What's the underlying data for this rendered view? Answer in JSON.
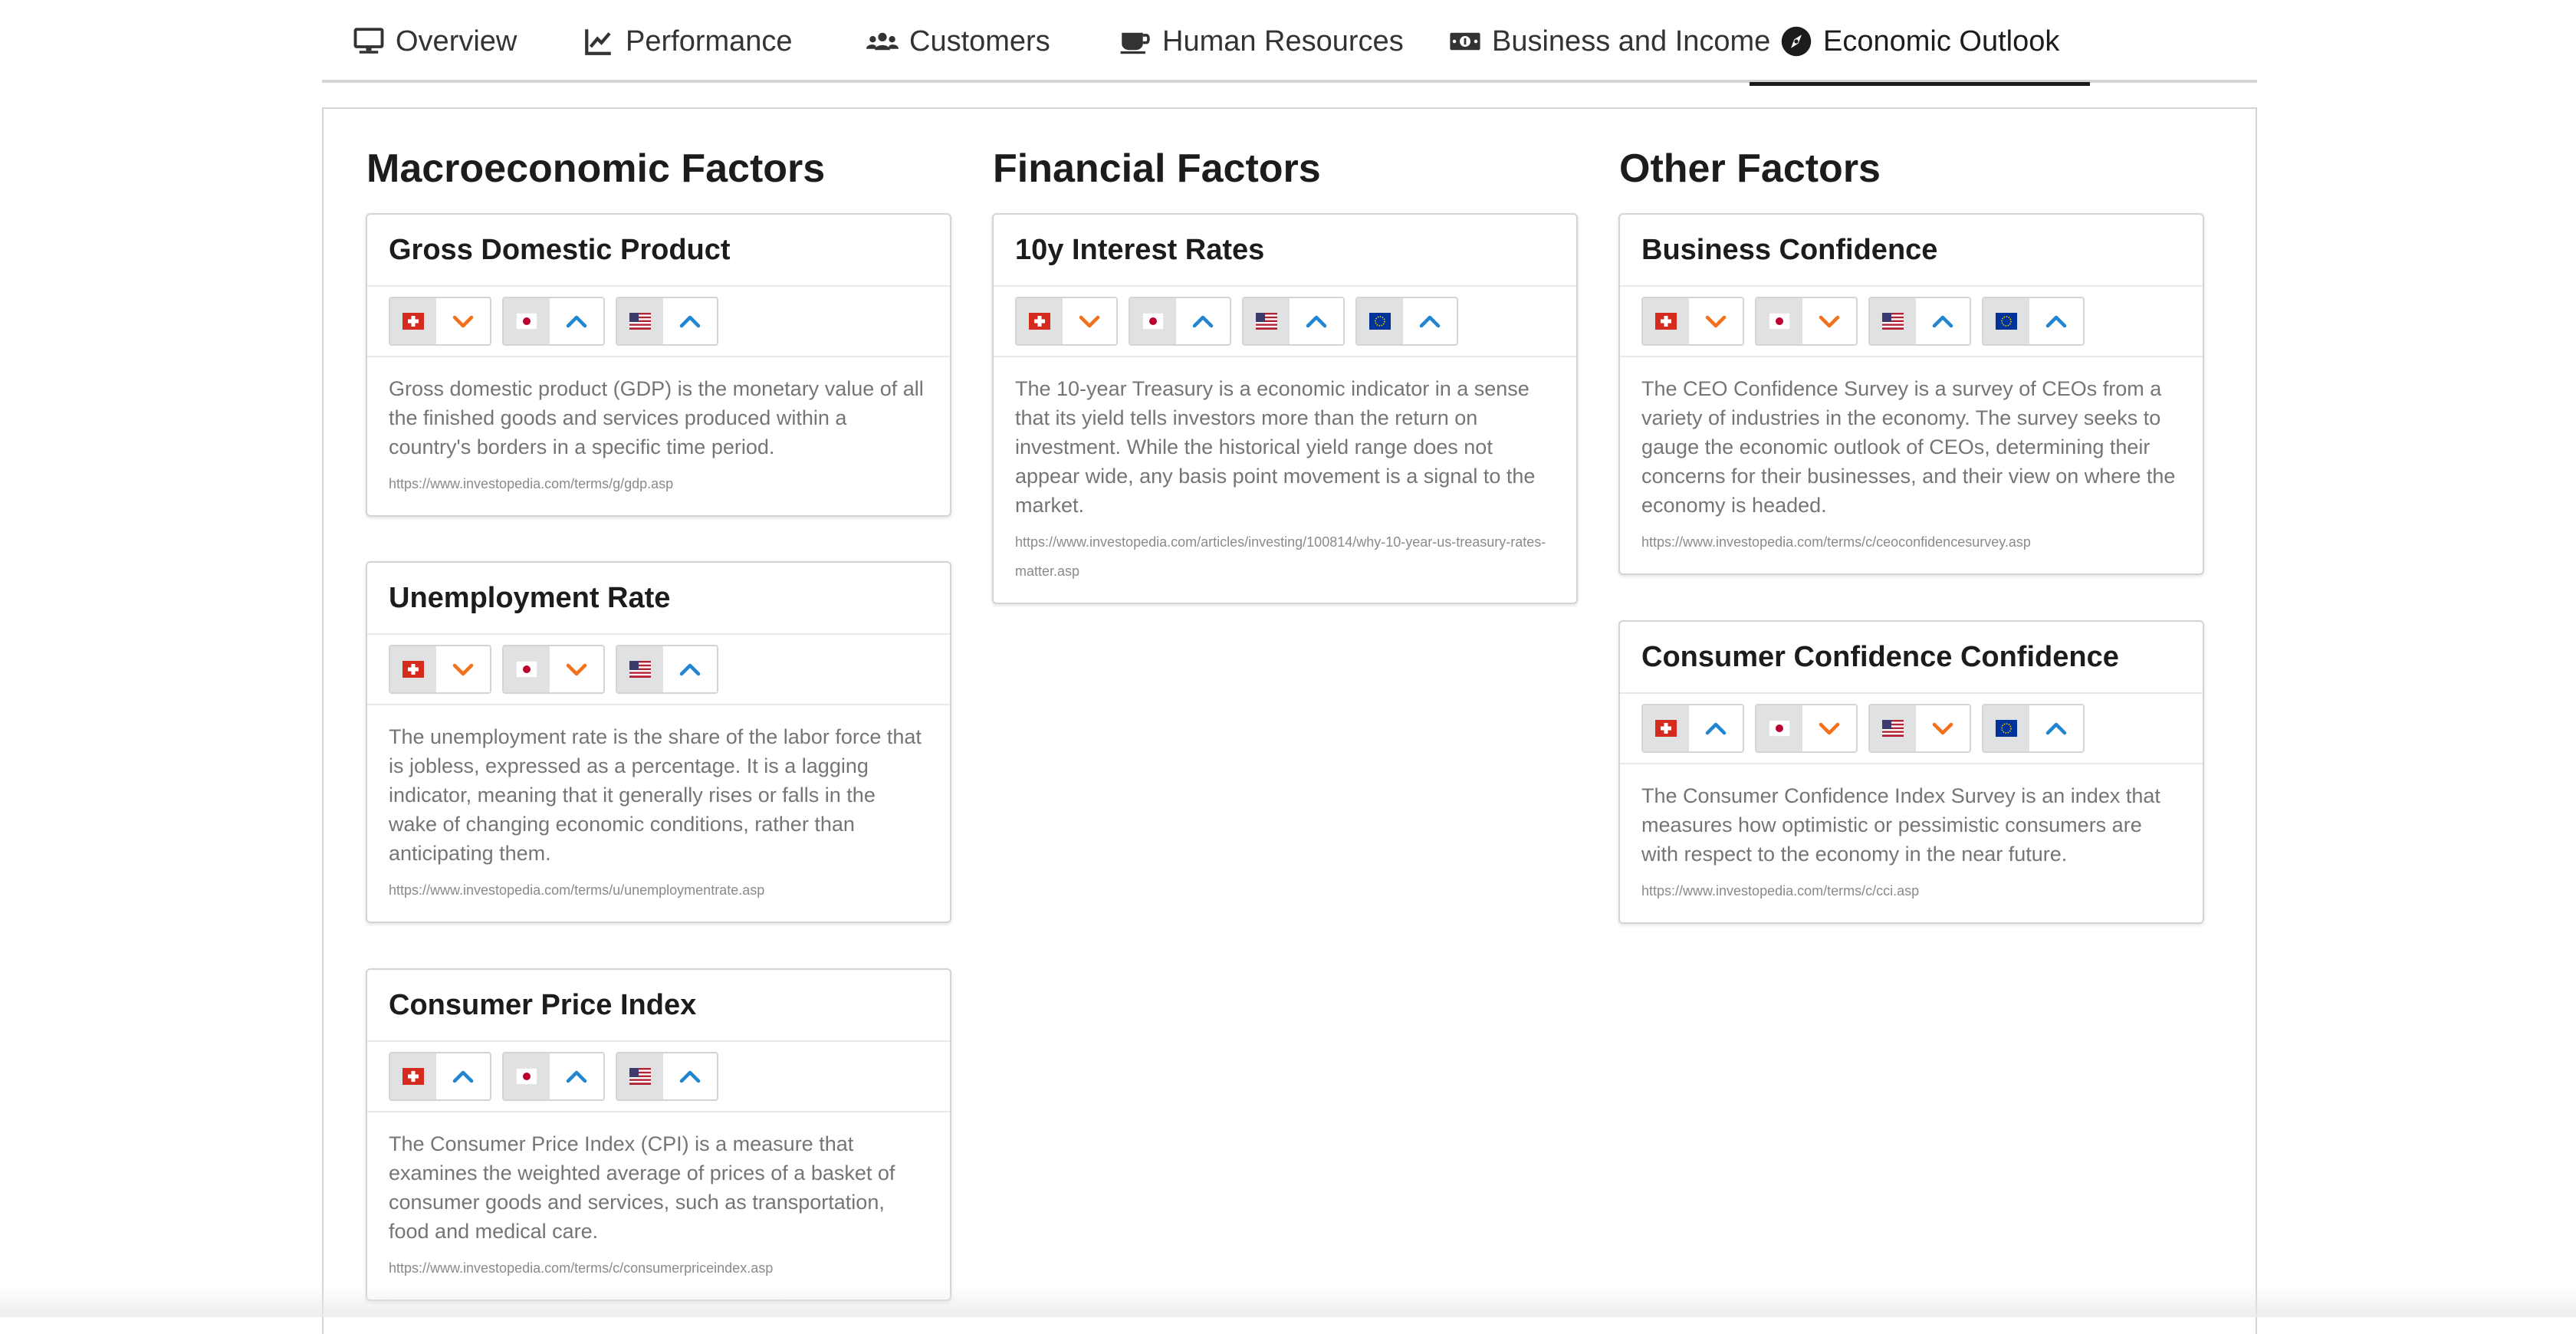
{
  "tabs": [
    {
      "label": "Overview",
      "icon": "monitor-icon"
    },
    {
      "label": "Performance",
      "icon": "line-chart-icon"
    },
    {
      "label": "Customers",
      "icon": "users-icon"
    },
    {
      "label": "Human Resources",
      "icon": "coffee-icon"
    },
    {
      "label": "Business and Income",
      "icon": "money-icon"
    },
    {
      "label": "Economic Outlook",
      "icon": "compass-icon",
      "active": true
    }
  ],
  "columns": [
    {
      "title": "Macroeconomic Factors",
      "cards": [
        {
          "title": "Gross Domestic Product",
          "indicators": [
            {
              "country": "switzerland",
              "trend": "down"
            },
            {
              "country": "japan",
              "trend": "up"
            },
            {
              "country": "usa",
              "trend": "up"
            }
          ],
          "description": "Gross domestic product (GDP) is the monetary value of all the finished goods and services produced within a country's borders in a specific time period.",
          "link": "https://www.investopedia.com/terms/g/gdp.asp"
        },
        {
          "title": "Unemployment Rate",
          "indicators": [
            {
              "country": "switzerland",
              "trend": "down"
            },
            {
              "country": "japan",
              "trend": "down"
            },
            {
              "country": "usa",
              "trend": "up"
            }
          ],
          "description": "The unemployment rate is the share of the labor force that is jobless, expressed as a percentage. It is a lagging indicator, meaning that it generally rises or falls in the wake of changing economic conditions, rather than anticipating them.",
          "link": "https://www.investopedia.com/terms/u/unemploymentrate.asp"
        },
        {
          "title": "Consumer Price Index",
          "indicators": [
            {
              "country": "switzerland",
              "trend": "up"
            },
            {
              "country": "japan",
              "trend": "up"
            },
            {
              "country": "usa",
              "trend": "up"
            }
          ],
          "description": "The Consumer Price Index (CPI) is a measure that examines the weighted average of prices of a basket of consumer goods and services, such as transportation, food and medical care.",
          "link": "https://www.investopedia.com/terms/c/consumerpriceindex.asp"
        }
      ]
    },
    {
      "title": "Financial Factors",
      "cards": [
        {
          "title": "10y Interest Rates",
          "indicators": [
            {
              "country": "switzerland",
              "trend": "down"
            },
            {
              "country": "japan",
              "trend": "up"
            },
            {
              "country": "usa",
              "trend": "up"
            },
            {
              "country": "eu",
              "trend": "up"
            }
          ],
          "description": "The 10-year Treasury is a economic indicator in a sense that its yield tells investors more than the return on investment. While the historical yield range does not appear wide, any basis point movement is a signal to the market.",
          "link": "https://www.investopedia.com/articles/investing/100814/why-10-year-us-treasury-rates-matter.asp"
        }
      ]
    },
    {
      "title": "Other Factors",
      "cards": [
        {
          "title": "Business Confidence",
          "indicators": [
            {
              "country": "switzerland",
              "trend": "down"
            },
            {
              "country": "japan",
              "trend": "down"
            },
            {
              "country": "usa",
              "trend": "up"
            },
            {
              "country": "eu",
              "trend": "up"
            }
          ],
          "description": "The CEO Confidence Survey is a survey of CEOs from a variety of industries in the economy. The survey seeks to gauge the economic outlook of CEOs, determining their concerns for their businesses, and their view on where the economy is headed.",
          "link": "https://www.investopedia.com/terms/c/ceoconfidencesurvey.asp"
        },
        {
          "title": "Consumer Confidence Confidence",
          "indicators": [
            {
              "country": "switzerland",
              "trend": "up"
            },
            {
              "country": "japan",
              "trend": "down"
            },
            {
              "country": "usa",
              "trend": "down"
            },
            {
              "country": "eu",
              "trend": "up"
            }
          ],
          "description": "The Consumer Confidence Index Survey is an index that measures how optimistic or pessimistic consumers are with respect to the economy in the near future.",
          "link": "https://www.investopedia.com/terms/c/cci.asp"
        }
      ]
    }
  ],
  "colors": {
    "up": "#2185d0",
    "down": "#f2711c",
    "text": "#1b1c1d",
    "muted": "#757575",
    "border": "#d4d4d5"
  }
}
